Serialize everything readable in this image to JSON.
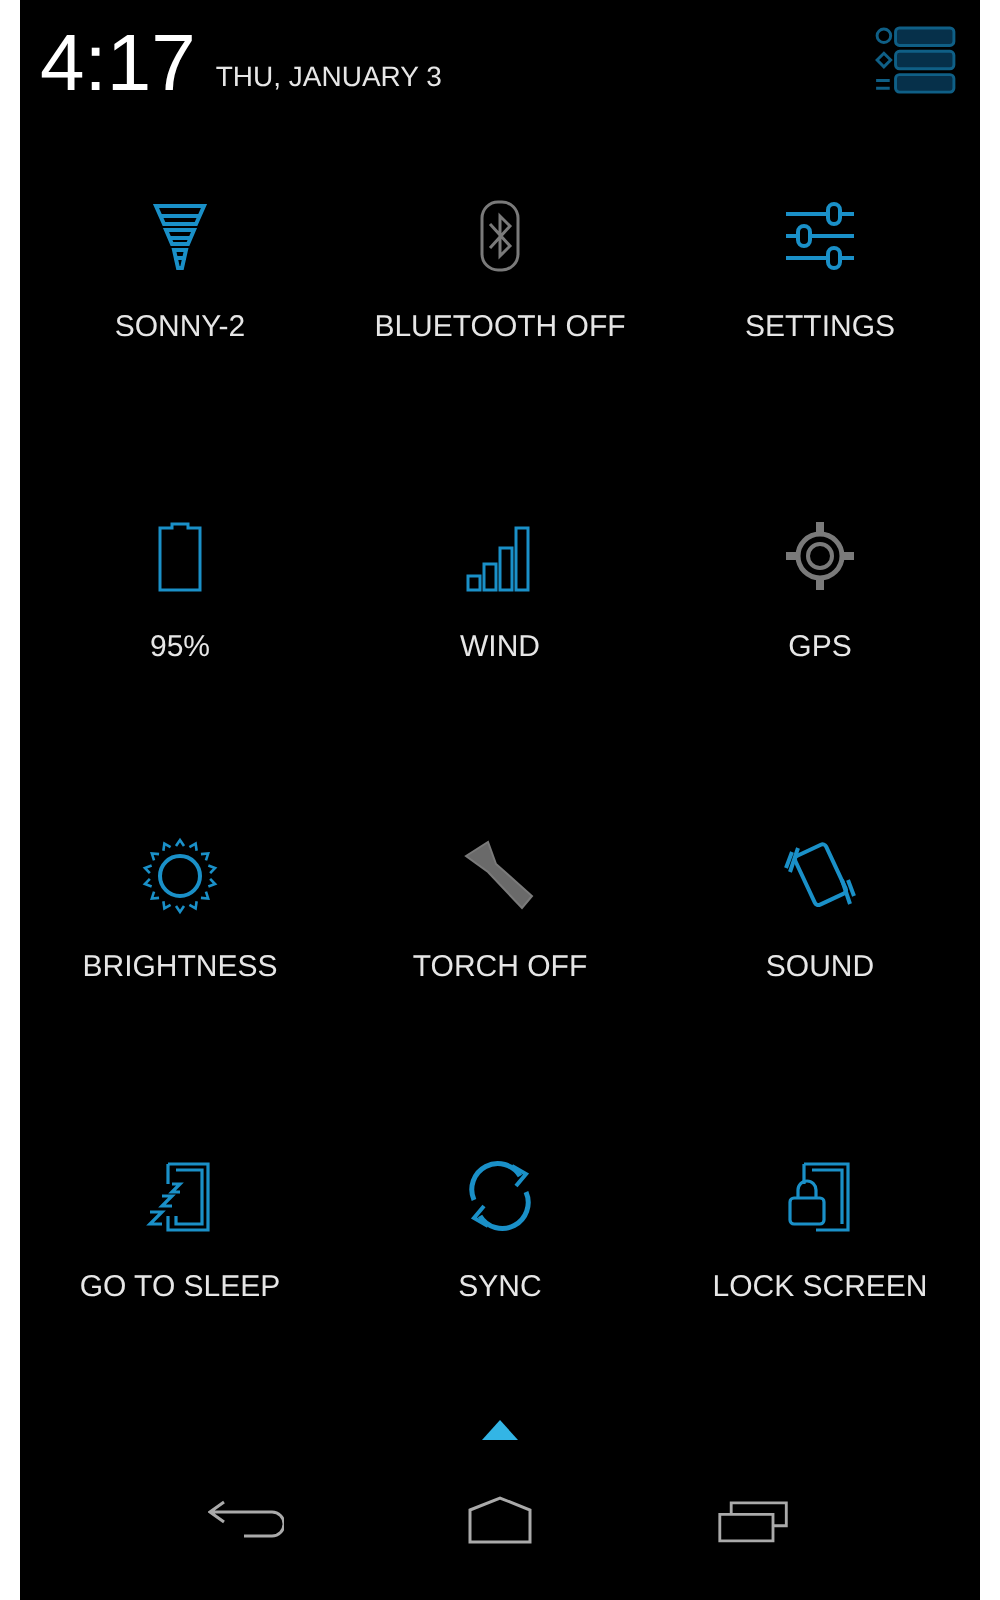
{
  "status": {
    "time": "4:17",
    "date": "THU, JANUARY 3"
  },
  "tiles": [
    {
      "label": "SONNY-2",
      "kind": "wifi",
      "on": true
    },
    {
      "label": "BLUETOOTH OFF",
      "kind": "bluetooth",
      "on": false
    },
    {
      "label": "SETTINGS",
      "kind": "settings",
      "on": true
    },
    {
      "label": "95%",
      "kind": "battery",
      "on": true
    },
    {
      "label": "WIND",
      "kind": "signal",
      "on": true
    },
    {
      "label": "GPS",
      "kind": "gps",
      "on": false
    },
    {
      "label": "BRIGHTNESS",
      "kind": "brightness",
      "on": true
    },
    {
      "label": "TORCH OFF",
      "kind": "torch",
      "on": false
    },
    {
      "label": "SOUND",
      "kind": "sound",
      "on": true
    },
    {
      "label": "GO TO SLEEP",
      "kind": "sleep",
      "on": true
    },
    {
      "label": "SYNC",
      "kind": "sync",
      "on": true
    },
    {
      "label": "LOCK SCREEN",
      "kind": "lock",
      "on": true
    }
  ]
}
